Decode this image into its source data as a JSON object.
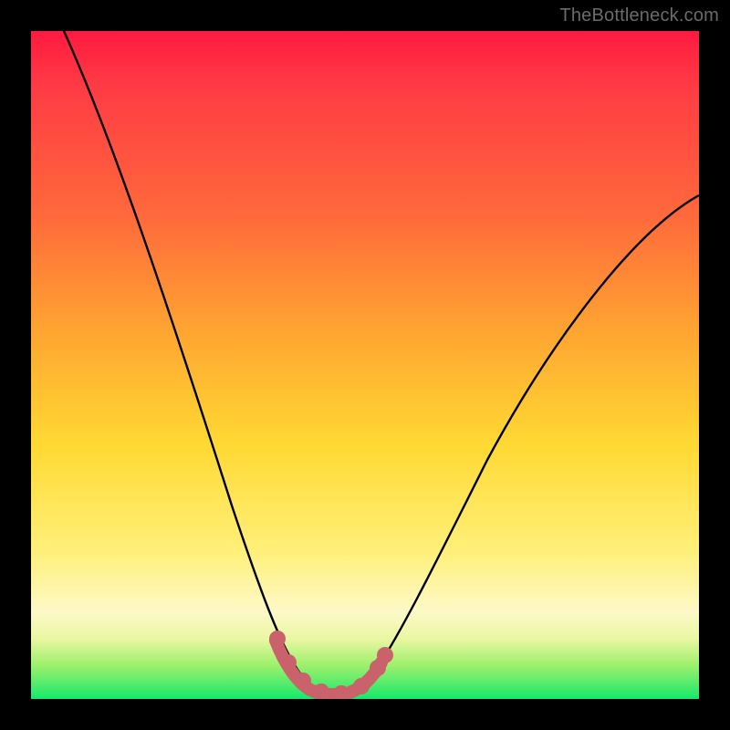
{
  "watermark": "TheBottleneck.com",
  "chart_data": {
    "type": "line",
    "title": "",
    "xlabel": "",
    "ylabel": "",
    "ylim": [
      0,
      100
    ],
    "xlim": [
      0,
      100
    ],
    "series": [
      {
        "name": "bottleneck-curve",
        "x": [
          0,
          5,
          10,
          15,
          20,
          25,
          30,
          33,
          36,
          38,
          40,
          42,
          44,
          46,
          48,
          52,
          56,
          60,
          65,
          70,
          75,
          80,
          85,
          90,
          95,
          100
        ],
        "values": [
          100,
          90,
          80,
          70,
          59,
          48,
          36,
          28,
          19,
          12,
          6,
          2,
          0,
          0,
          2,
          7,
          14,
          22,
          31,
          39,
          47,
          54,
          60,
          66,
          71,
          75
        ]
      },
      {
        "name": "marker-band",
        "x": [
          36,
          38,
          40,
          42,
          44,
          46,
          48
        ],
        "values": [
          5,
          3,
          2,
          1,
          1,
          2,
          4
        ]
      }
    ],
    "colors": {
      "curve": "#000000",
      "markers": "#c9626a",
      "gradient_top": "#ff1a3f",
      "gradient_bottom": "#17e86b"
    }
  }
}
